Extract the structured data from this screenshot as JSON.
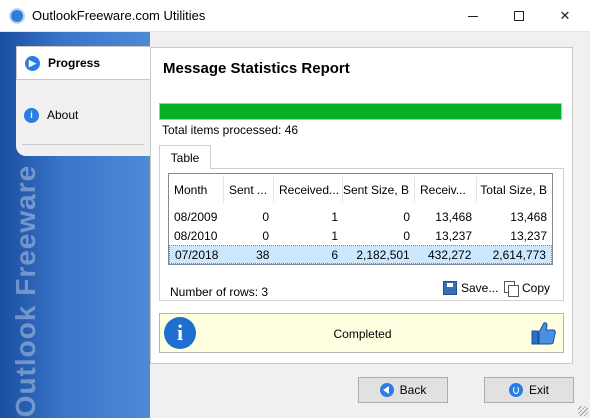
{
  "window": {
    "title": "OutlookFreeware.com Utilities"
  },
  "sidebar": {
    "watermark": "Outlook Freeware .com",
    "items": [
      {
        "label": "Progress",
        "icon": "play-icon",
        "active": true
      },
      {
        "label": "About",
        "icon": "info-icon",
        "active": false
      }
    ]
  },
  "main": {
    "title": "Message Statistics Report",
    "progress_fraction": 1.0,
    "progress_color": "#06b025",
    "progress_text": "Total items processed: 46",
    "tab_label": "Table",
    "table": {
      "columns": [
        "Month",
        "Sent ...",
        "Received...",
        "Sent Size, B",
        "Receiv...",
        "Total Size, B"
      ],
      "rows": [
        [
          "08/2009",
          "0",
          "1",
          "0",
          "13,468",
          "13,468"
        ],
        [
          "08/2010",
          "0",
          "1",
          "0",
          "13,237",
          "13,237"
        ],
        [
          "07/2018",
          "38",
          "6",
          "2,182,501",
          "432,272",
          "2,614,773"
        ]
      ],
      "selected_row": 2
    },
    "rows_count_text": "Number of rows:  3",
    "save_label": "Save...",
    "copy_label": "Copy",
    "status_text": "Completed",
    "status_icon_glyph": "i"
  },
  "footer": {
    "back_label": "Back",
    "exit_label": "Exit"
  }
}
